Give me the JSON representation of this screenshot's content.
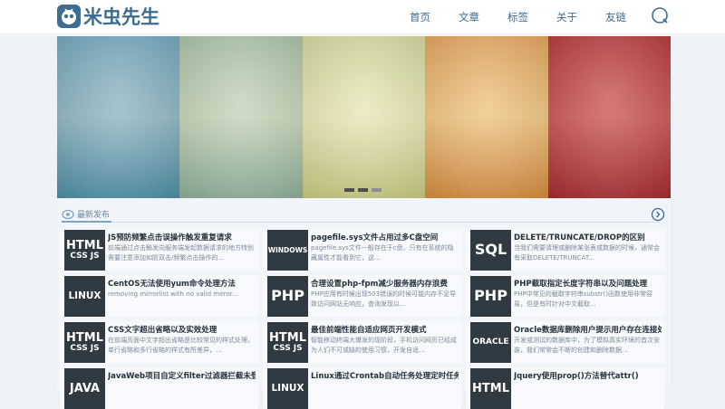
{
  "header": {
    "logo_text": "米虫先生",
    "nav": [
      "首页",
      "文章",
      "标签",
      "关于",
      "友链"
    ]
  },
  "section": {
    "title": "最新发布"
  },
  "posts": [
    {
      "thumb": [
        "HTML",
        "CSS JS"
      ],
      "title": "JS预防频繁点击误操作触发重复请求",
      "desc": "前端通过点击触发向服务端发起数据请求的地方特别需要注意添加如防双击/频繁点击操作的..."
    },
    {
      "thumb": [
        "WINDOWS"
      ],
      "title": "pagefile.sys文件占用过多C盘空间",
      "desc": "pagefile.sys文件一般存在于c盘，只有在系统的隐藏属性才能看到它，这..."
    },
    {
      "thumb": [
        "SQL"
      ],
      "title": "DELETE/TRUNCATE/DROP的区别",
      "desc": "当我们需要清理或删除某张表或数据的时候，通常会有采取DELETE/TRUNCAT..."
    },
    {
      "thumb": [
        "LINUX"
      ],
      "title": "CentOS无法使用yum命令处理方法",
      "desc": "removing mirrorlist with no valid mirror..."
    },
    {
      "thumb": [
        "PHP"
      ],
      "title": "合理设置php-fpm减少服务器内存浪费",
      "desc": "PHP应用有时候出现503错误的时候可能内存不足导致访问网站无响应，查询发现以..."
    },
    {
      "thumb": [
        "PHP"
      ],
      "title": "PHP截取指定长度字符串以及问题处理",
      "desc": "PHP中常见的截取字符串substr()函数使用非常容易，但是有时针对中文截取..."
    },
    {
      "thumb": [
        "HTML",
        "CSS JS"
      ],
      "title": "CSS文字超出省略以及实效处理",
      "desc": "在前端页面中文字超出省略是比较常见的样式处理，单行省略和多行省略的样式有所差异，..."
    },
    {
      "thumb": [
        "HTML",
        "CSS JS"
      ],
      "title": "最佳前端性能自适应网页开发模式",
      "desc": "智能移动终端大爆发的现阶段，手机访问网页已经成为人们不可或缺的使用习惯，开发自适..."
    },
    {
      "thumb": [
        "ORACLE"
      ],
      "title": "Oracle数据库删除用户提示用户存在连接处理...",
      "desc": "开发或测试的数据库中，为了模拟真实环境的首次安装，我们常常会不断的创建和删除数据..."
    },
    {
      "thumb": [
        "JAVA"
      ],
      "title": "JavaWeb项目自定义filter过滤器拦截未登录...",
      "desc": ""
    },
    {
      "thumb": [
        "LINUX"
      ],
      "title": "Linux通过Crontab自动任务处理定时任务",
      "desc": ""
    },
    {
      "thumb": [
        "HTML"
      ],
      "title": "Jquery使用prop()方法替代attr()",
      "desc": ""
    }
  ]
}
